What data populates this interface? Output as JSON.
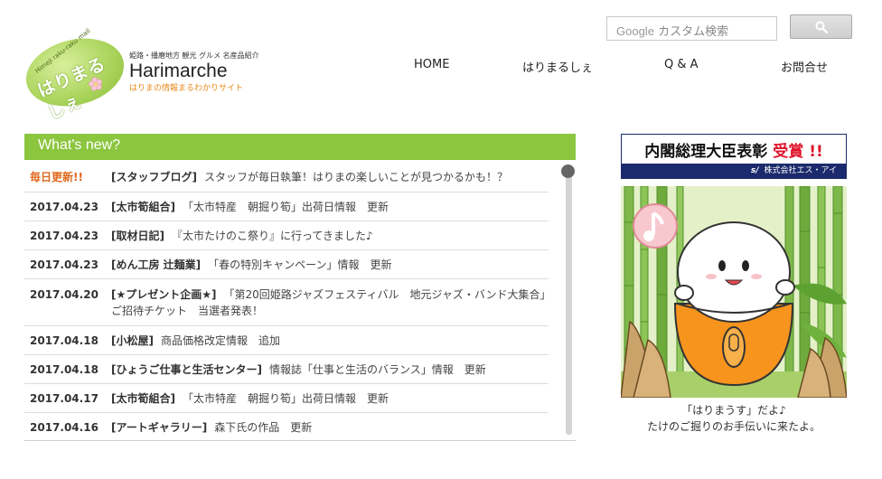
{
  "logo": {
    "curve_text": "Himeji raku-raku mall",
    "mark_text": "はりまるしぇ",
    "tagline": "姫路・播磨地方 観光 グルメ 名産品紹介",
    "name": "Harimarche",
    "subtitle": "はりまの情報まるわかりサイト"
  },
  "search": {
    "google_label": "Google",
    "placeholder": "カスタム検索",
    "button_icon": "search-icon"
  },
  "nav": [
    {
      "label": "HOME"
    },
    {
      "label": "はりまるしぇ"
    },
    {
      "label": "Q & A"
    },
    {
      "label": "お問合せ"
    }
  ],
  "news": {
    "title": "What's new?",
    "items": [
      {
        "date": "毎日更新!!",
        "category": "[スタッフブログ]",
        "text": "スタッフが毎日執筆！はりまの楽しいことが見つかるかも！？"
      },
      {
        "date": "2017.04.23",
        "category": "[太市筍組合]",
        "text": "「太市特産　朝掘り筍」出荷日情報　更新"
      },
      {
        "date": "2017.04.23",
        "category": "[取材日記]",
        "text": "『太市たけのこ祭り』に行ってきました♪"
      },
      {
        "date": "2017.04.23",
        "category": "[めん工房 辻麺業]",
        "text": "「春の特別キャンペーン」情報　更新"
      },
      {
        "date": "2017.04.20",
        "category": "[★プレゼント企画★]",
        "text": "「第20回姫路ジャズフェスティバル　地元ジャズ・バンド大集合」ご招待チケット　当選者発表！"
      },
      {
        "date": "2017.04.18",
        "category": "[小松屋]",
        "text": "商品価格改定情報　追加"
      },
      {
        "date": "2017.04.18",
        "category": "[ひょうご仕事と生活センター]",
        "text": "情報誌「仕事と生活のバランス」情報　更新"
      },
      {
        "date": "2017.04.17",
        "category": "[太市筍組合]",
        "text": "「太市特産　朝掘り筍」出荷日情報　更新"
      },
      {
        "date": "2017.04.16",
        "category": "[アートギャラリー]",
        "text": "森下氏の作品　更新"
      }
    ]
  },
  "award": {
    "main": "内閣総理大臣表彰",
    "highlight": "受賞 !!",
    "company": "株式会社エス・アイ",
    "company_mark": "s/"
  },
  "mascot": {
    "caption_line1": "「はりまうす」だよ♪",
    "caption_line2": "たけのご掘りのお手伝いに来たよ。"
  },
  "colors": {
    "news_header": "#8cc63f",
    "highlight_date": "#e0671c",
    "award_navy": "#1a2a6c",
    "award_red": "#e0142c"
  }
}
